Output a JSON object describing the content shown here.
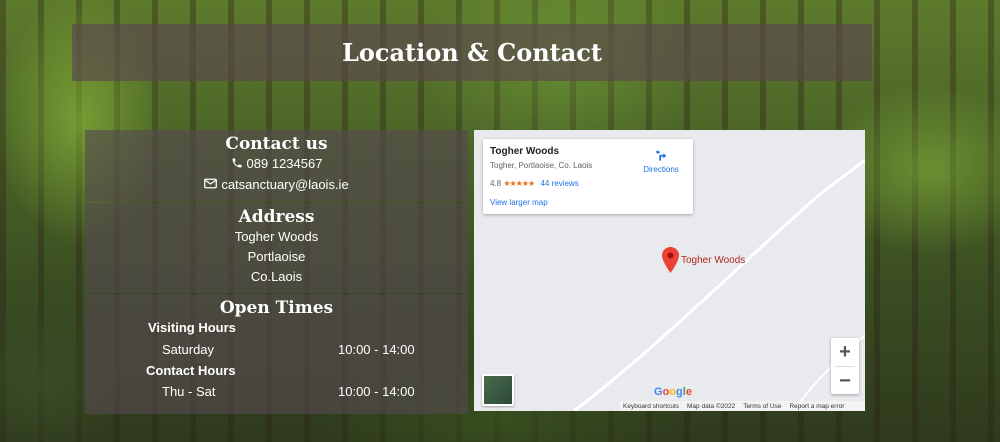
{
  "page": {
    "title": "Location & Contact"
  },
  "contact": {
    "heading": "Contact us",
    "phone": "089 1234567",
    "email": "catsanctuary@laois.ie",
    "phone_icon": "phone-icon",
    "email_icon": "envelope-icon"
  },
  "address": {
    "heading": "Address",
    "lines": [
      "Togher Woods",
      "Portlaoise",
      "Co.Laois"
    ]
  },
  "open_times": {
    "heading": "Open Times",
    "sections": [
      {
        "label": "Visiting Hours",
        "day": "Saturday",
        "hours": "10:00 - 14:00"
      },
      {
        "label": "Contact Hours",
        "day": "Thu - Sat",
        "hours": "10:00 - 14:00"
      }
    ]
  },
  "map": {
    "place_name": "Togher Woods",
    "place_address": "Togher, Portlaoise, Co. Laois",
    "rating": "4.8",
    "stars": "★★★★★",
    "reviews": "44 reviews",
    "view_larger": "View larger map",
    "directions": "Directions",
    "pin_label": "Togher Woods",
    "zoom_in": "+",
    "zoom_out": "−",
    "logo_letters": [
      "G",
      "o",
      "o",
      "g",
      "l",
      "e"
    ],
    "attribution": {
      "shortcuts": "Keyboard shortcuts",
      "map_data": "Map data ©2022",
      "terms": "Terms of Use",
      "report": "Report a map error"
    },
    "colors": {
      "pin": "#ea4335",
      "link": "#1a73e8",
      "stars": "#e7711b"
    }
  }
}
